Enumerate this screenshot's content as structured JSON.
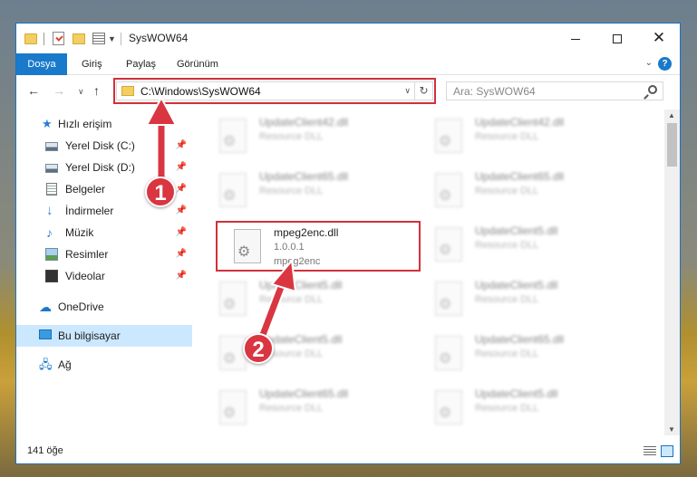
{
  "titlebar": {
    "title": "SysWOW64",
    "minimize": "",
    "maximize": "",
    "close": "✕"
  },
  "ribbon": {
    "tabs": [
      "Dosya",
      "Giriş",
      "Paylaş",
      "Görünüm"
    ],
    "help": "?"
  },
  "nav": {
    "address": "C:\\Windows\\SysWOW64",
    "search_placeholder": "Ara: SysWOW64"
  },
  "sidebar": {
    "items": [
      {
        "label": "Hızlı erişim",
        "icon": "star-icon"
      },
      {
        "label": "Yerel Disk (C:)",
        "icon": "disk-icon",
        "pinned": true
      },
      {
        "label": "Yerel Disk (D:)",
        "icon": "disk-icon",
        "pinned": true
      },
      {
        "label": "Belgeler",
        "icon": "document-icon",
        "pinned": true
      },
      {
        "label": "İndirmeler",
        "icon": "download-icon",
        "pinned": true
      },
      {
        "label": "Müzik",
        "icon": "music-icon",
        "pinned": true
      },
      {
        "label": "Resimler",
        "icon": "pictures-icon",
        "pinned": true
      },
      {
        "label": "Videolar",
        "icon": "video-icon",
        "pinned": true
      },
      {
        "label": "OneDrive",
        "icon": "cloud-icon"
      },
      {
        "label": "Bu bilgisayar",
        "icon": "computer-icon",
        "selected": true
      },
      {
        "label": "Ağ",
        "icon": "network-icon"
      }
    ]
  },
  "files": {
    "left": [
      {
        "name": "UpdateClient42.dll",
        "desc": "Resource DLL"
      },
      {
        "name": "UpdateClient65.dll",
        "desc": "Resource DLL"
      },
      {
        "name": "UpdateClient5.dll",
        "desc": "Resource DLL"
      },
      {
        "name": "UpdateClient5.dll",
        "desc": "Resource DLL"
      },
      {
        "name": "UpdateClient65.dll",
        "desc": "Resource DLL"
      }
    ],
    "right": [
      {
        "name": "UpdateClient42.dll",
        "desc": "Resource DLL"
      },
      {
        "name": "UpdateClient65.dll",
        "desc": "Resource DLL"
      },
      {
        "name": "UpdateClient5.dll",
        "desc": "Resource DLL"
      },
      {
        "name": "UpdateClient5.dll",
        "desc": "Resource DLL"
      },
      {
        "name": "UpdateClient65.dll",
        "desc": "Resource DLL"
      },
      {
        "name": "UpdateClient5.dll",
        "desc": "Resource DLL"
      }
    ],
    "highlighted": {
      "name": "mpeg2enc.dll",
      "version": "1.0.0.1",
      "desc": "mpeg2enc"
    }
  },
  "status": {
    "count": "141 öğe"
  },
  "annotations": {
    "step1": "1",
    "step2": "2"
  },
  "colors": {
    "accent": "#1979ca",
    "highlight": "#d0313b",
    "selected": "#cce8ff"
  }
}
